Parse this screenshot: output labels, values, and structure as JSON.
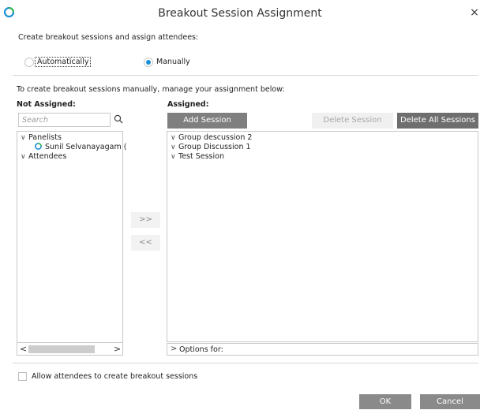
{
  "window": {
    "title": "Breakout Session Assignment",
    "close_glyph": "×"
  },
  "intro_text": "Create breakout sessions and assign attendees:",
  "mode": {
    "automatic_label": "Automatically",
    "manual_label": "Manually",
    "selected": "Manually"
  },
  "manage_text": "To create breakout sessions manually, manage your assignment below:",
  "not_assigned": {
    "heading": "Not Assigned:",
    "search_placeholder": "Search",
    "tree": [
      {
        "label": "Panelists",
        "expanded": true,
        "children": [
          {
            "label": "Sunil Selvanayagam (",
            "icon": "webex-presence-icon"
          }
        ]
      },
      {
        "label": "Attendees",
        "expanded": true,
        "children": []
      }
    ]
  },
  "move_buttons": {
    "assign": ">>",
    "unassign": "<<"
  },
  "assigned": {
    "heading": "Assigned:",
    "add_session": "Add Session",
    "delete_session": "Delete Session",
    "delete_all_sessions": "Delete All Sessions",
    "sessions": [
      {
        "label": "Group descussion 2"
      },
      {
        "label": "Group Discussion 1"
      },
      {
        "label": "Test Session"
      }
    ],
    "options_label": "Options for:"
  },
  "allow_create_label": "Allow attendees to create breakout sessions",
  "footer": {
    "ok": "OK",
    "cancel": "Cancel"
  },
  "colors": {
    "accent": "#1a8fd6",
    "button_dark": "#7f7f7f",
    "button_disabled_bg": "#f0f0f0"
  }
}
